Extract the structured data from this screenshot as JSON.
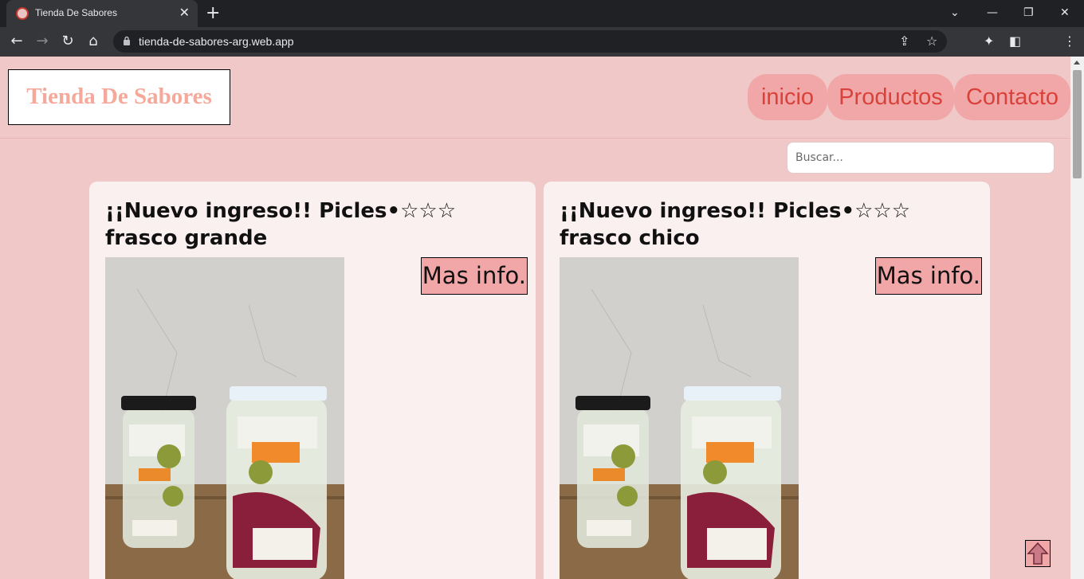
{
  "browser": {
    "tab_title": "Tienda De Sabores",
    "tab_close": "✕",
    "new_tab": "+",
    "url": "tienda-de-sabores-arg.web.app",
    "min": "—",
    "restore": "❐",
    "close": "✕"
  },
  "site": {
    "logo": "Tienda De Sabores",
    "nav": [
      {
        "label": "inicio"
      },
      {
        "label": "Productos"
      },
      {
        "label": "Contacto"
      }
    ],
    "search": {
      "placeholder": "Buscar...",
      "value": ""
    }
  },
  "products": [
    {
      "title": "¡¡Nuevo ingreso!! Picles•☆☆☆ frasco grande",
      "more_label": "Mas info."
    },
    {
      "title": "¡¡Nuevo ingreso!! Picles•☆☆☆ frasco chico",
      "more_label": "Mas info."
    }
  ],
  "colors": {
    "background": "#f0c8c8",
    "card": "#fbf0f0",
    "nav_pill": "#f1a7a7",
    "nav_text": "#d9423a",
    "logo_text": "#f5a99a"
  },
  "icons": {
    "back_to_top": "arrow-up-icon"
  }
}
